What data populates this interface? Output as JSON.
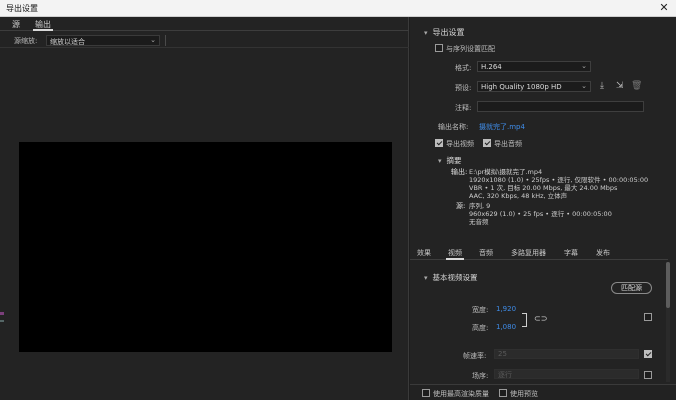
{
  "window": {
    "title": "导出设置",
    "close_glyph": "✕"
  },
  "left": {
    "tabs": [
      "源",
      "输出"
    ],
    "scale_label": "源缩放:",
    "scale_value": "缩放以适合"
  },
  "export_settings": {
    "header": "导出设置",
    "match_sequence_label": "与序列设置匹配",
    "format_label": "格式:",
    "format_value": "H.264",
    "preset_label": "预设:",
    "preset_value": "High Quality 1080p HD",
    "comment_label": "注释:",
    "comment_value": "",
    "output_name_label": "输出名称:",
    "output_name_value": "摄就完了.mp4",
    "export_video_label": "导出视频",
    "export_audio_label": "导出音频",
    "summary": {
      "header": "摘要",
      "output_key": "输出:",
      "output_lines": [
        "E:\\pr模拟\\摄就完了.mp4",
        "1920x1080 (1.0) • 25fps • 逐行, 仅限软件 • 00:00:05:00",
        "VBR • 1 次, 目标 20.00 Mbps, 最大 24.00 Mbps",
        "AAC, 320 Kbps, 48 kHz, 立体声"
      ],
      "source_key": "源:",
      "source_lines": [
        "序列, 9",
        "960x629 (1.0) • 25 fps • 逐行 • 00:00:05:00",
        "无音频"
      ]
    }
  },
  "video_tabs": [
    "效果",
    "视频",
    "音频",
    "多路复用器",
    "字幕",
    "发布"
  ],
  "basic_video": {
    "header": "基本视频设置",
    "match_source_button": "匹配源",
    "width_label": "宽度:",
    "width_value": "1,920",
    "height_label": "高度:",
    "height_value": "1,080",
    "frame_rate_label": "帧速率:",
    "frame_rate_value": "25",
    "field_order_label": "场序:",
    "field_order_value": "逐行"
  },
  "bottom": {
    "max_render_quality": "使用最高渲染质量",
    "use_previews": "使用预览"
  },
  "icons": {
    "save_preset": "save-preset-icon",
    "import_preset": "import-preset-icon",
    "delete_preset": "trash-icon"
  }
}
